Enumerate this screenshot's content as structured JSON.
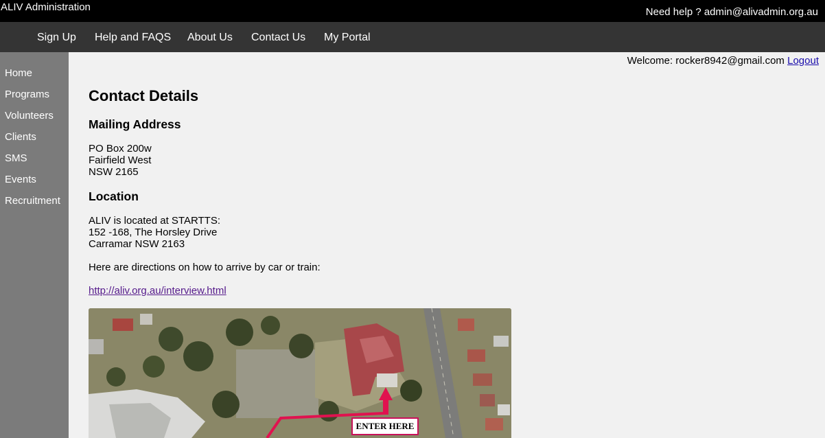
{
  "header": {
    "app_title": "ALIV Administration",
    "help_text": "Need help ? admin@alivadmin.org.au"
  },
  "nav": {
    "items": [
      "Sign Up",
      "Help and FAQS",
      "About Us",
      "Contact Us",
      "My Portal"
    ]
  },
  "sidebar": {
    "items": [
      "Home",
      "Programs",
      "Volunteers",
      "Clients",
      "SMS",
      "Events",
      "Recruitment"
    ]
  },
  "user": {
    "welcome": "Welcome: rocker8942@gmail.com",
    "logout": "Logout"
  },
  "page": {
    "title": "Contact Details",
    "mailing_heading": "Mailing Address",
    "mailing_lines": [
      "PO Box 200w",
      "Fairfield West",
      "NSW 2165"
    ],
    "location_heading": "Location",
    "location_lines": [
      "ALIV is located at STARTTS:",
      "152 -168, The Horsley Drive",
      "Carramar NSW 2163"
    ],
    "directions_text": "Here are directions on how to arrive by car or train:",
    "directions_link": "http://aliv.org.au/interview.html"
  },
  "map": {
    "enter_label": "ENTER HERE",
    "route_color": "#e0124f"
  }
}
